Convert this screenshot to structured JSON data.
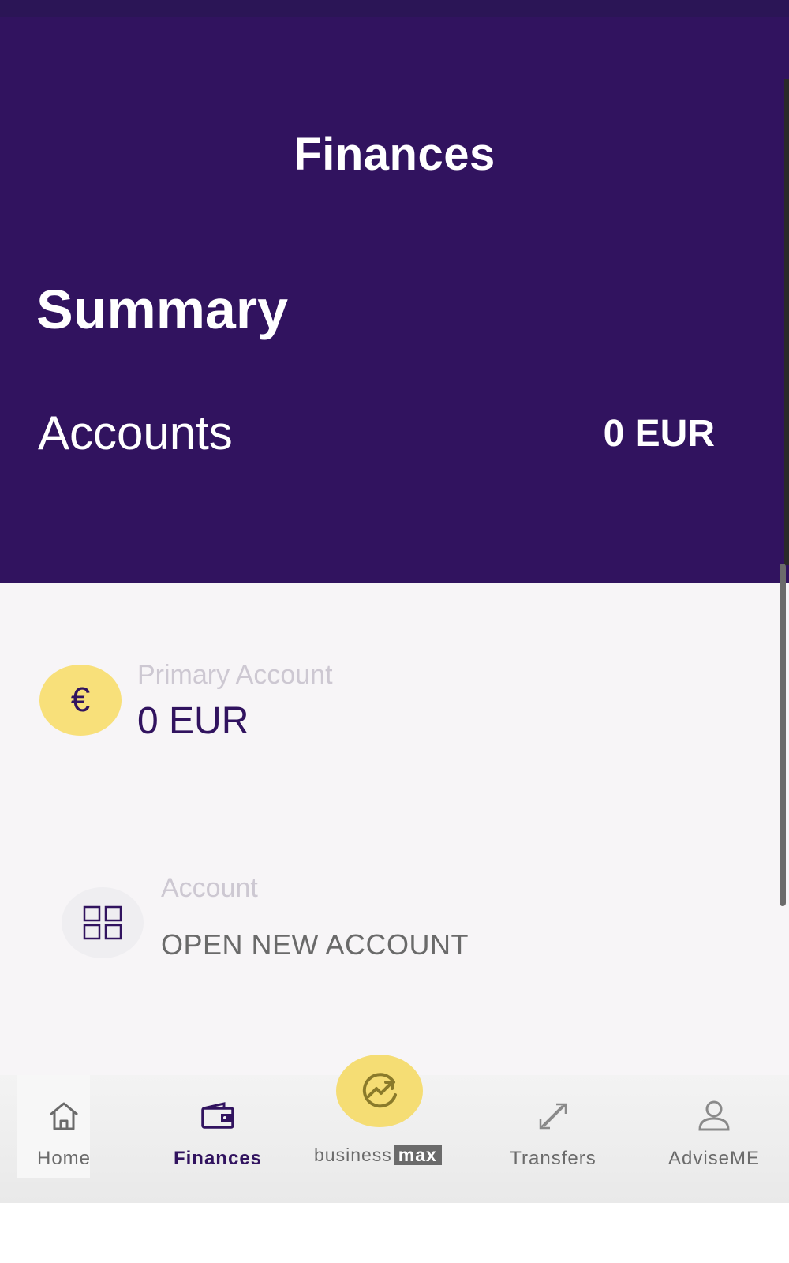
{
  "header": {
    "title": "Finances",
    "summary_title": "Summary",
    "accounts_label": "Accounts",
    "accounts_total": "0 EUR"
  },
  "accounts": [
    {
      "icon": "euro-icon",
      "symbol": "€",
      "name": "Primary Account",
      "balance": "0 EUR"
    }
  ],
  "open_account": {
    "icon": "grid-icon",
    "small_label": "Account",
    "label": "OPEN NEW ACCOUNT"
  },
  "tabbar": {
    "tabs": [
      {
        "label": "Home",
        "icon": "home-icon"
      },
      {
        "label": "Finances",
        "icon": "wallet-icon",
        "active": true
      },
      {
        "label": "business",
        "suffix": "max",
        "icon": "trend-up-icon"
      },
      {
        "label": "Transfers",
        "icon": "transfer-arrows-icon"
      },
      {
        "label": "AdviseME",
        "icon": "person-icon"
      }
    ]
  },
  "colors": {
    "brand": "#31135f",
    "accent": "#f8e07a",
    "text_muted": "#6b6b6b"
  }
}
